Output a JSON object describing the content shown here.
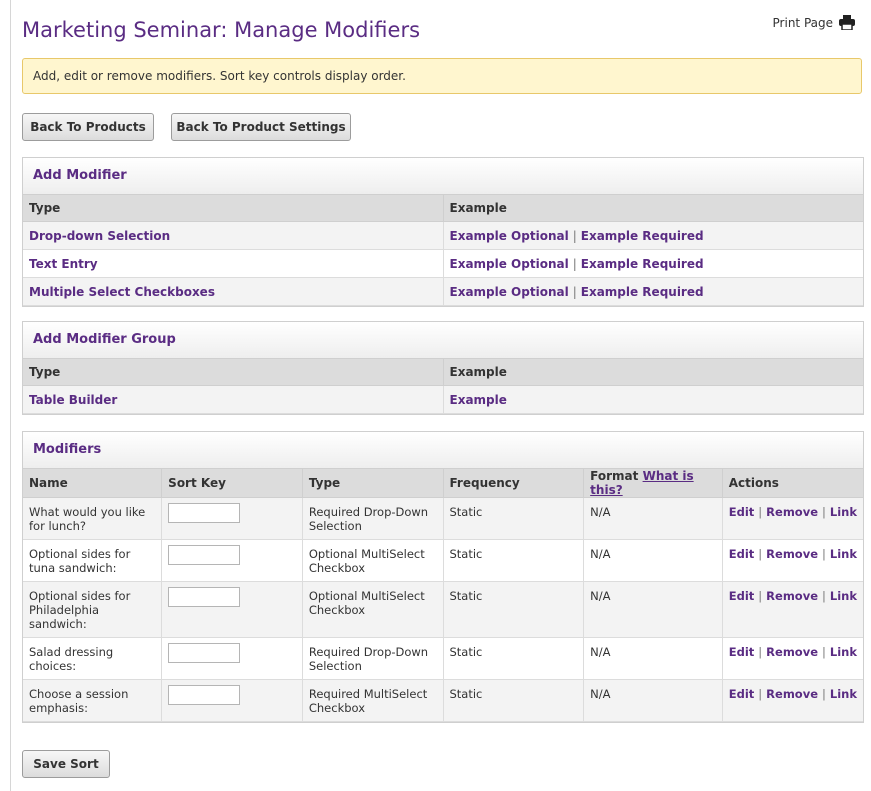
{
  "page": {
    "title": "Marketing Seminar: Manage Modifiers",
    "print_label": "Print Page",
    "notice": "Add, edit or remove modifiers. Sort key controls display order."
  },
  "buttons": {
    "back_to_products": "Back To Products",
    "back_to_settings": "Back To Product Settings",
    "save_sort": "Save Sort"
  },
  "add_modifier": {
    "title": "Add Modifier",
    "columns": [
      "Type",
      "Example"
    ],
    "rows": [
      {
        "type": "Drop-down Selection",
        "optional": "Example Optional",
        "sep": "|",
        "required": "Example Required"
      },
      {
        "type": "Text Entry",
        "optional": "Example Optional",
        "sep": "|",
        "required": "Example Required"
      },
      {
        "type": "Multiple Select Checkboxes",
        "optional": "Example Optional",
        "sep": "|",
        "required": "Example Required"
      }
    ]
  },
  "add_group": {
    "title": "Add Modifier Group",
    "columns": [
      "Type",
      "Example"
    ],
    "rows": [
      {
        "type": "Table Builder",
        "example": "Example"
      }
    ]
  },
  "modifiers": {
    "title": "Modifiers",
    "columns": {
      "name": "Name",
      "sort_key": "Sort Key",
      "type": "Type",
      "frequency": "Frequency",
      "format": "Format",
      "what_is_this": "What is this?",
      "actions": "Actions"
    },
    "rows": [
      {
        "name": "What would you like for lunch?",
        "sort_key": "",
        "type": "Required Drop-Down Selection",
        "frequency": "Static",
        "format": "N/A",
        "edit": "Edit",
        "remove": "Remove",
        "link": "Link",
        "sep": "|"
      },
      {
        "name": "Optional sides for tuna sandwich:",
        "sort_key": "",
        "type": "Optional MultiSelect Checkbox",
        "frequency": "Static",
        "format": "N/A",
        "edit": "Edit",
        "remove": "Remove",
        "link": "Link",
        "sep": "|"
      },
      {
        "name": "Optional sides for Philadelphia sandwich:",
        "sort_key": "",
        "type": "Optional MultiSelect Checkbox",
        "frequency": "Static",
        "format": "N/A",
        "edit": "Edit",
        "remove": "Remove",
        "link": "Link",
        "sep": "|"
      },
      {
        "name": "Salad dressing choices:",
        "sort_key": "",
        "type": "Required Drop-Down Selection",
        "frequency": "Static",
        "format": "N/A",
        "edit": "Edit",
        "remove": "Remove",
        "link": "Link",
        "sep": "|"
      },
      {
        "name": "Choose a session emphasis:",
        "sort_key": "",
        "type": "Required MultiSelect Checkbox",
        "frequency": "Static",
        "format": "N/A",
        "edit": "Edit",
        "remove": "Remove",
        "link": "Link",
        "sep": "|"
      }
    ]
  },
  "icons": {
    "print": "printer-icon"
  },
  "colors": {
    "accent": "#5a2c83",
    "notice_bg": "#fff6cf",
    "notice_border": "#e8c86a",
    "header_bg": "#dcdcdc"
  }
}
